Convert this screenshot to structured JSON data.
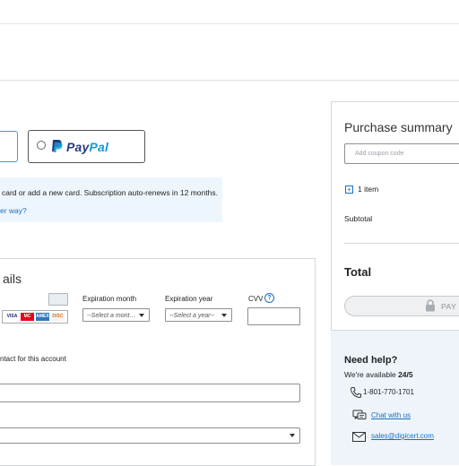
{
  "payment_methods": {
    "paypal_label_pay": "Pay",
    "paypal_label_pal": "Pal"
  },
  "info": {
    "text": "card or add a new card. Subscription auto-renews in 12 months.",
    "link": "er way?"
  },
  "card_details": {
    "title": "ails",
    "expiration_month_label": "Expiration month",
    "expiration_month_value": "--Select a mont…",
    "expiration_year_label": "Expiration year",
    "expiration_year_value": "--Select a year--",
    "cvv_label": "CVV",
    "cvv_help": "?",
    "contact_text": "ntact for this account",
    "card_logos": [
      "VISA",
      "MC",
      "AMEX",
      "DISC"
    ]
  },
  "summary": {
    "title": "Purchase summary",
    "coupon_placeholder": "Add coupon code",
    "items": "1 item",
    "subtotal_label": "Subtotal",
    "total_label": "Total",
    "pay_label": "PAY"
  },
  "help": {
    "title": "Need help?",
    "available_prefix": "We're available ",
    "available_hours": "24/5",
    "phone": "1-801-770-1701",
    "chat": "Chat with us",
    "email": "sales@digicert.com"
  },
  "colors": {
    "accent": "#1a6fc4",
    "paypal_dark": "#263b80",
    "paypal_light": "#139ad6",
    "info_bg": "#eef6fd",
    "help_bg": "#eef4fa"
  }
}
